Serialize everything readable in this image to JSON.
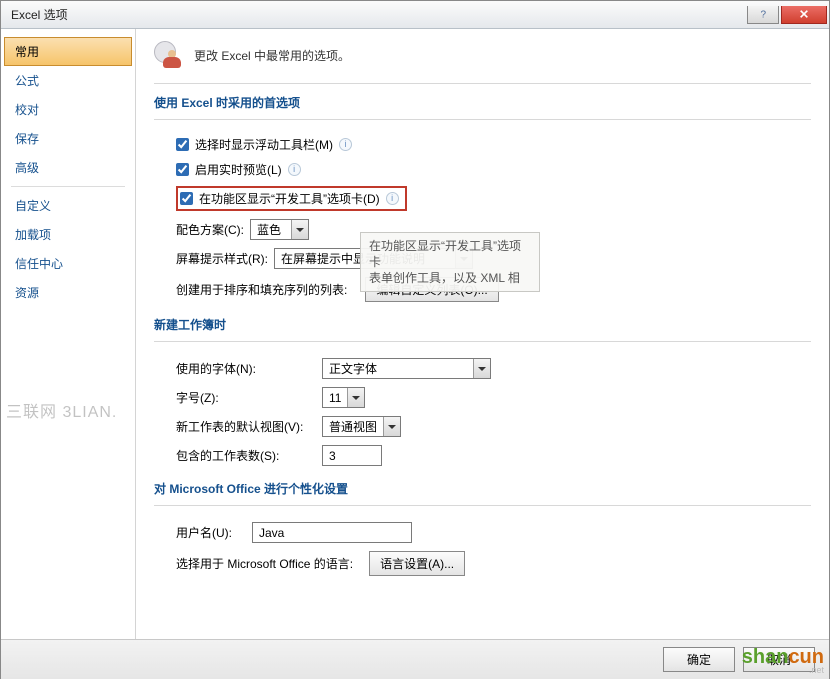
{
  "title": "Excel 选项",
  "header": {
    "text": "更改 Excel 中最常用的选项。"
  },
  "sidebar": {
    "items": [
      {
        "label": "常用",
        "selected": true
      },
      {
        "label": "公式"
      },
      {
        "label": "校对"
      },
      {
        "label": "保存"
      },
      {
        "label": "高级"
      },
      {
        "label": "自定义"
      },
      {
        "label": "加载项"
      },
      {
        "label": "信任中心"
      },
      {
        "label": "资源"
      }
    ]
  },
  "sections": {
    "top": {
      "title": "使用 Excel 时采用的首选项",
      "cb_minitoolbar": "选择时显示浮动工具栏(M)",
      "cb_livepreview": "启用实时预览(L)",
      "cb_devtab": "在功能区显示“开发工具”选项卡(D)",
      "color_scheme_label": "配色方案(C):",
      "color_scheme_value": "蓝色",
      "screentip_label": "屏幕提示样式(R):",
      "screentip_value": "在屏幕提示中显示功能说明",
      "sortfill_label": "创建用于排序和填充序列的列表:",
      "sortfill_btn": "编辑自定义列表(O)..."
    },
    "newbook": {
      "title": "新建工作簿时",
      "font_label": "使用的字体(N):",
      "font_value": "正文字体",
      "size_label": "字号(Z):",
      "size_value": "11",
      "view_label": "新工作表的默认视图(V):",
      "view_value": "普通视图",
      "sheets_label": "包含的工作表数(S):",
      "sheets_value": "3"
    },
    "personalize": {
      "title": "对 Microsoft Office 进行个性化设置",
      "user_label": "用户名(U):",
      "user_value": "Java",
      "lang_label": "选择用于 Microsoft Office 的语言:",
      "lang_btn": "语言设置(A)..."
    }
  },
  "ghost_tip": {
    "line1": "在功能区显示“开发工具”选项卡",
    "line2": "表单创作工具，以及 XML 相"
  },
  "footer": {
    "ok": "确定",
    "cancel": "取消"
  },
  "watermark": "三联网 3LIAN.",
  "brand": {
    "p1": "shan",
    "p2": "cun",
    "net": ".net"
  }
}
